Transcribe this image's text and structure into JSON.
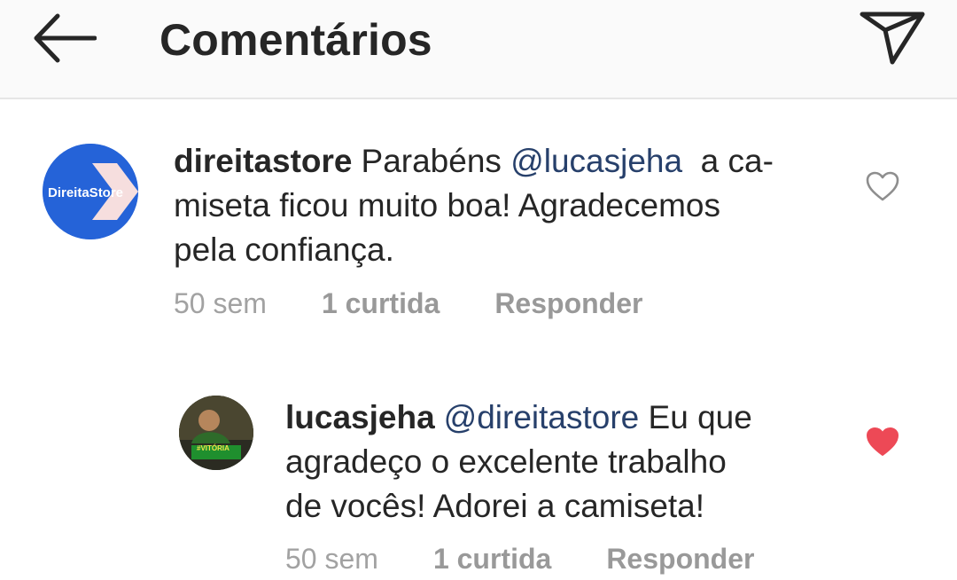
{
  "header": {
    "title": "Comentários",
    "back_icon": "arrow-left-icon",
    "send_icon": "paper-plane-icon"
  },
  "comments": [
    {
      "username": "direitastore",
      "text_before": "Parabéns ",
      "mention": "@lucasjeha",
      "text_line1_after": "  a ca-",
      "text_line2": "miseta ficou muito boa! Agradecemos",
      "text_line3": "pela confiança.",
      "avatar_text": "DireitaStore",
      "time": "50 sem",
      "likes": "1 curtida",
      "reply": "Responder",
      "liked": false
    },
    {
      "username": "lucasjeha",
      "mention": "@direitastore",
      "text_line1_after": " Eu que",
      "text_line2": "agradeço o excelente trabalho",
      "text_line3": "de vocês! Adorei a camiseta!",
      "avatar_text": "#VITÓRIA",
      "time": "50 sem",
      "likes": "1 curtida",
      "reply": "Responder",
      "liked": true
    }
  ],
  "colors": {
    "mention": "#27406b",
    "heart_liked": "#ed4956",
    "meta": "#a2a2a2",
    "avatar_blue": "#2563d8"
  }
}
